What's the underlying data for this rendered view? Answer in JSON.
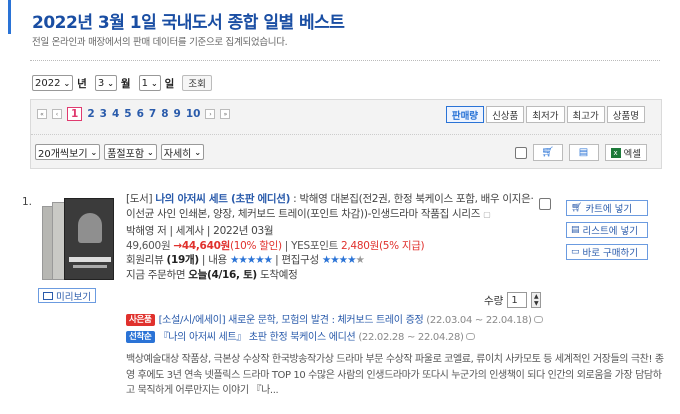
{
  "header": {
    "title": "2022년 3월 1일 국내도서 종합 일별 베스트",
    "subtitle": "전일 온라인과 매장에서의 판매 데이터를 기준으로 집계되었습니다."
  },
  "date_selector": {
    "year": "2022",
    "year_suffix": "년",
    "month": "3",
    "month_suffix": "월",
    "day": "1",
    "day_suffix": "일",
    "query_button": "조회"
  },
  "pager": {
    "current": "1",
    "pages": [
      "2",
      "3",
      "4",
      "5",
      "6",
      "7",
      "8",
      "9",
      "10"
    ],
    "first": "«",
    "prev": "‹",
    "next": "›",
    "last": "»"
  },
  "sort_tabs": [
    "판매량",
    "신상품",
    "최저가",
    "최고가",
    "상품명"
  ],
  "filters": {
    "per_page": "20개씩보기",
    "stock": "품절포함",
    "view": "자세히"
  },
  "tools": {
    "excel": "엑셀"
  },
  "item": {
    "rank": "1.",
    "title_prefix": "[도서]",
    "title_main": "나의 아저씨 세트 (초판 에디션)",
    "title_rest": ": 박해영 대본집(전2권, 한정 북케이스 포함, 배우 이지은·이선균 사인 인쇄본, 양장, 체커보드 트레이(포인트 차감))-인생드라마 작품집 시리즈",
    "author_line": "박해영 저 | 세계사 | 2022년 03월",
    "price_original": "49,600원",
    "price_arrow": "→",
    "price_sale": "44,640원",
    "price_pct": "(10% 할인)",
    "points_label": "| YES포인트",
    "points_value": "2,480원",
    "points_pct": "(5% 지급)",
    "review_label": "회원리뷰",
    "review_count": "(19개)",
    "content_label": "| 내용",
    "content_stars": "★★★★★",
    "edit_label": "| 편집구성",
    "edit_stars": "★★★★",
    "edit_stars_empty": "★",
    "delivery_prefix": "지금 주문하면",
    "delivery_date": "오늘(4/16, 토)",
    "delivery_suffix": "도착예정",
    "qty_label": "수량",
    "qty_value": "1",
    "preview_label": "미리보기"
  },
  "actions": {
    "cart": "카트에 넣기",
    "list": "리스트에 넣기",
    "buy": "바로 구매하기"
  },
  "events": [
    {
      "badge": "사은품",
      "text": "[소설/시/에세이] 새로운 문학, 모험의 발견 : 체커보드 트레이 증정",
      "date": "(22.03.04 ~ 22.04.18)"
    },
    {
      "badge": "선착순",
      "text": "『나의 아저씨 세트』 초판 한정 북케이스 에디션",
      "date": "(22.02.28 ~ 22.04.28)"
    }
  ],
  "description": "백상예술대상 작품상, 극본상 수상작 한국방송작가상 드라마 부문 수상작 파울로 코엘료, 류이치 사카모토 등 세계적인 거장들의 극찬! 종영 후에도 3년 연속 넷플릭스 드라마 TOP 10 수많은 사람의 인생드라마가 또다시 누군가의 인생책이 되다 인간의 외로움을 가장 담담하고 묵직하게 어루만지는 이야기 『나...",
  "colors": {
    "title_blue": "#1a4ea3",
    "link_blue": "#2a5bab",
    "accent_blue": "#2a73d6",
    "sale_red": "#e0312d",
    "active_page": "#e03a6f"
  }
}
